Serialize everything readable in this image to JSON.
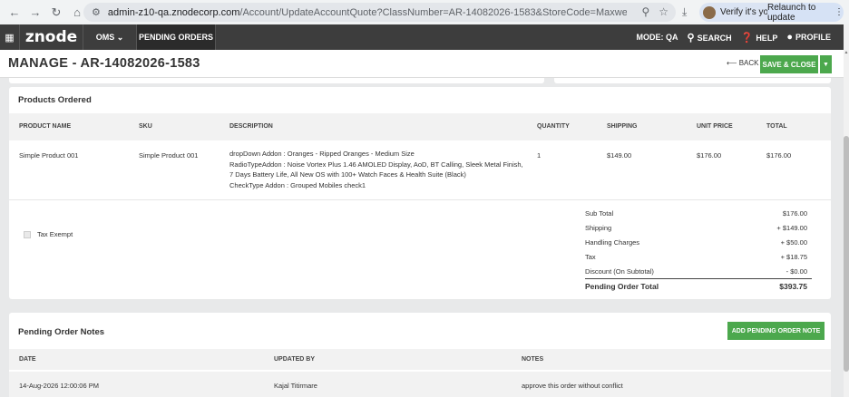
{
  "browser": {
    "url_host": "admin-z10-qa.znodecorp.com",
    "url_rest": "/Account/UpdateAccountQuote?ClassNumber=AR-14082026-1583&StoreCode=MaxwellsHardware&updatePageType=...",
    "verify_label": "Verify it's you",
    "relaunch_label": "Relaunch to update"
  },
  "nav": {
    "logo": "znode",
    "oms_label": "OMS",
    "pending_orders_label": "PENDING ORDERS",
    "mode_label": "MODE: QA",
    "search_label": "SEARCH",
    "help_label": "HELP",
    "profile_label": "PROFILE"
  },
  "header": {
    "title": "MANAGE - AR-14082026-1583",
    "back_label": "BACK",
    "save_label": "SAVE & CLOSE"
  },
  "products": {
    "title": "Products Ordered",
    "columns": [
      "PRODUCT NAME",
      "SKU",
      "DESCRIPTION",
      "QUANTITY",
      "SHIPPING",
      "UNIT PRICE",
      "TOTAL"
    ],
    "row": {
      "name": "Simple Product 001",
      "sku": "Simple Product 001",
      "description": [
        "dropDown Addon : Oranges - Ripped Oranges - Medium Size",
        "RadioTypeAddon : Noise Vortex Plus 1.46 AMOLED Display, AoD, BT Calling, Sleek Metal Finish,",
        "7 Days Battery Life, All New OS with 100+ Watch Faces & Health Suite (Black)",
        "CheckType Addon : Grouped Mobiles check1"
      ],
      "quantity": "1",
      "shipping": "$149.00",
      "unit_price": "$176.00",
      "total": "$176.00"
    },
    "tax_exempt_label": "Tax Exempt",
    "summary": [
      {
        "label": "Sub Total",
        "value": "$176.00"
      },
      {
        "label": "Shipping",
        "value": "+ $149.00"
      },
      {
        "label": "Handling Charges",
        "value": "+ $50.00"
      },
      {
        "label": "Tax",
        "value": "+ $18.75"
      },
      {
        "label": "Discount (On Subtotal)",
        "value": "- $0.00"
      }
    ],
    "grand_total_label": "Pending Order Total",
    "grand_total_value": "$393.75"
  },
  "notes": {
    "title": "Pending Order Notes",
    "add_label": "ADD PENDING ORDER NOTE",
    "columns": [
      "DATE",
      "UPDATED BY",
      "NOTES"
    ],
    "row": {
      "date": "14-Aug-2026 12:00:06 PM",
      "updated_by": "Kajal Titirmare",
      "notes": "approve this order without conflict"
    }
  },
  "colors": {
    "accent_green": "#4ca84d",
    "nav_bg": "#3d3d3d"
  }
}
